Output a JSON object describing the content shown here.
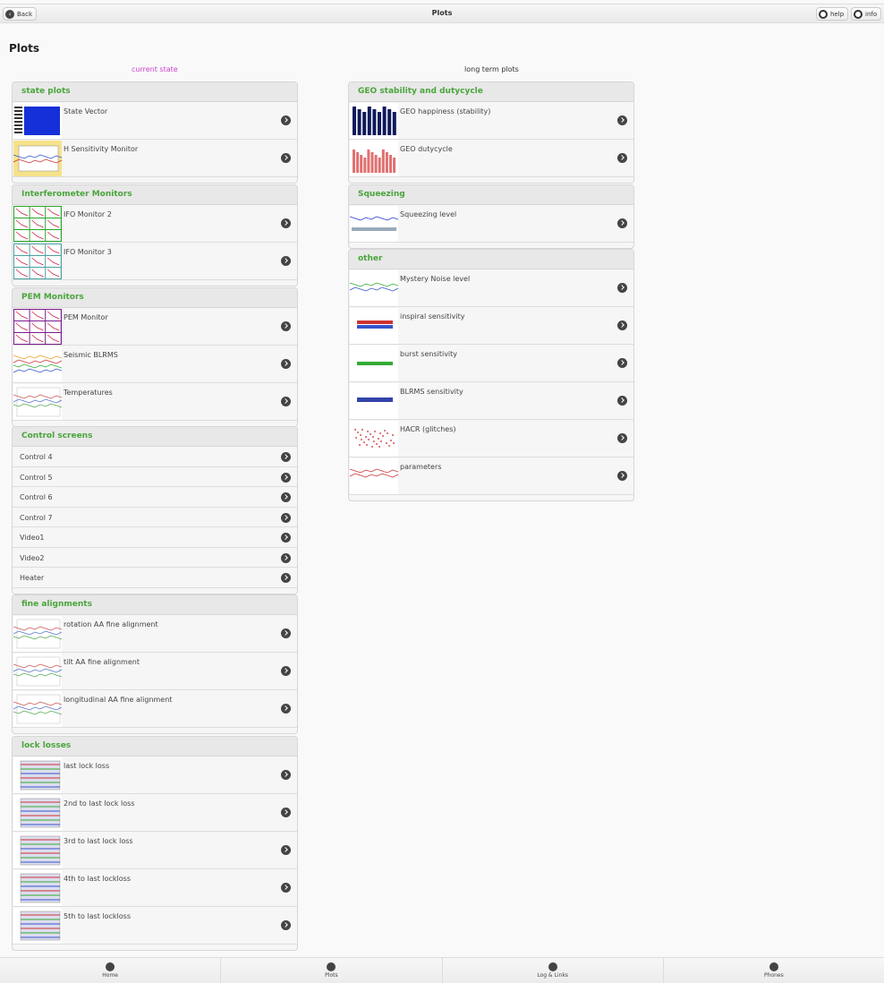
{
  "header": {
    "back_label": "Back",
    "title": "Plots",
    "help_label": "help",
    "info_label": "info"
  },
  "page": {
    "title": "Plots",
    "left_column_label": "current state",
    "right_column_label": "long term plots"
  },
  "colors": {
    "accent_green": "#4aa53c",
    "magenta": "#cc44cc"
  },
  "left_panels": [
    {
      "title": "state plots",
      "kind": "thumb",
      "items": [
        {
          "label": "State Vector",
          "thumb": "blue-grid"
        },
        {
          "label": "H Sensitivity Monitor",
          "thumb": "yellow-spectrum"
        }
      ]
    },
    {
      "title": "Interferometer Monitors",
      "kind": "thumb",
      "items": [
        {
          "label": "IFO Monitor 2",
          "thumb": "green-grid"
        },
        {
          "label": "IFO Monitor 3",
          "thumb": "teal-grid"
        }
      ]
    },
    {
      "title": "PEM Monitors",
      "kind": "thumb",
      "items": [
        {
          "label": "PEM Monitor",
          "thumb": "purple-grid"
        },
        {
          "label": "Seismic BLRMS",
          "thumb": "colored-lines"
        },
        {
          "label": "Temperatures",
          "thumb": "flat-lines"
        }
      ]
    },
    {
      "title": "Control screens",
      "kind": "simple",
      "items": [
        {
          "label": "Control 4"
        },
        {
          "label": "Control 5"
        },
        {
          "label": "Control 6"
        },
        {
          "label": "Control 7"
        },
        {
          "label": "Video1"
        },
        {
          "label": "Video2"
        },
        {
          "label": "Heater"
        }
      ]
    },
    {
      "title": "fine alignments",
      "kind": "thumb",
      "items": [
        {
          "label": "rotation AA fine alignment",
          "thumb": "flat-lines"
        },
        {
          "label": "tilt AA fine alignment",
          "thumb": "flat-lines"
        },
        {
          "label": "longitudinal AA fine alignment",
          "thumb": "flat-lines"
        }
      ]
    },
    {
      "title": "lock losses",
      "kind": "thumb",
      "items": [
        {
          "label": "last lock loss",
          "thumb": "lock-loss"
        },
        {
          "label": "2nd to last lock loss",
          "thumb": "lock-loss"
        },
        {
          "label": "3rd to last lock loss",
          "thumb": "lock-loss"
        },
        {
          "label": "4th to last lockloss",
          "thumb": "lock-loss"
        },
        {
          "label": "5th to last lockloss",
          "thumb": "lock-loss"
        }
      ]
    }
  ],
  "right_panels": [
    {
      "title": "GEO stability and dutycycle",
      "kind": "thumb",
      "items": [
        {
          "label": "GEO happiness (stability)",
          "thumb": "navy-bars"
        },
        {
          "label": "GEO dutycycle",
          "thumb": "red-bars"
        }
      ]
    },
    {
      "title": "Squeezing",
      "kind": "thumb",
      "items": [
        {
          "label": "Squeezing level",
          "thumb": "blue-noise"
        }
      ]
    },
    {
      "title": "other",
      "kind": "thumb",
      "items": [
        {
          "label": "Mystery Noise level",
          "thumb": "green-noise"
        },
        {
          "label": "inspiral sensitivity",
          "thumb": "red-blue-band"
        },
        {
          "label": "burst sensitivity",
          "thumb": "green-band"
        },
        {
          "label": "BLRMS sensitivity",
          "thumb": "blue-band"
        },
        {
          "label": "HACR (glitches)",
          "thumb": "red-scatter"
        },
        {
          "label": "parameters",
          "thumb": "red-lines"
        }
      ]
    }
  ],
  "footer": {
    "tabs": [
      {
        "label": "Home"
      },
      {
        "label": "Plots"
      },
      {
        "label": "Log & Links"
      },
      {
        "label": "Phones"
      }
    ]
  }
}
